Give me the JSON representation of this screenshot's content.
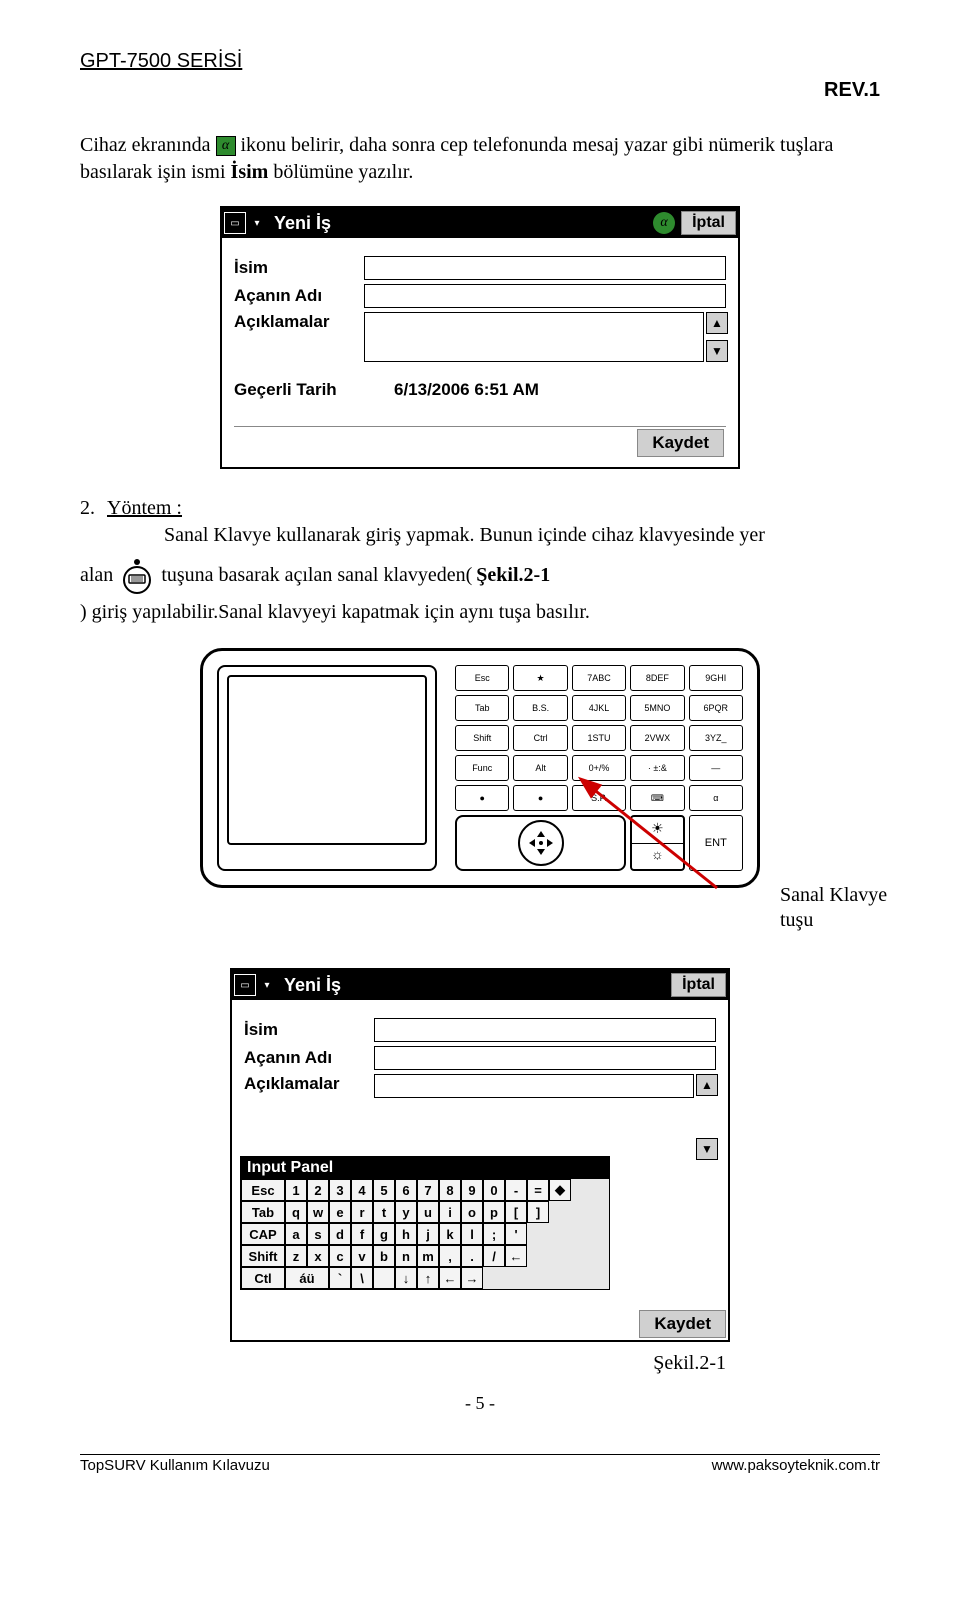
{
  "header": {
    "series": "GPT-7500 SERİSİ",
    "rev": "REV.1"
  },
  "intro": {
    "before_icon": "Cihaz ekranında",
    "alpha_glyph": "α",
    "after_icon": "ikonu belirir, daha sonra cep telefonunda mesaj yazar gibi nümerik tuşlara basılarak işin ismi ",
    "bold_isim": "İsim",
    "after_isim": " bölümüne yazılır."
  },
  "ss1": {
    "title": "Yeni İş",
    "alpha": "α",
    "cancel": "İptal",
    "labels": {
      "isim": "İsim",
      "acan": "Açanın Adı",
      "acik": "Açıklamalar",
      "tarih": "Geçerli Tarih"
    },
    "date_value": "6/13/2006 6:51 AM",
    "save": "Kaydet"
  },
  "method": {
    "num": "2.",
    "title": "Yöntem :",
    "line1": "Sanal Klavye kullanarak giriş yapmak. Bunun içinde cihaz klavyesinde yer",
    "line2a": "alan",
    "line2b": "tuşuna basarak açılan sanal klavyeden(",
    "ref": "Şekil.2-1",
    "line2c": ") giriş yapılabilir.Sanal klavyeyi kapatmak için aynı tuşa basılır."
  },
  "device": {
    "keys_r1": [
      "Esc",
      "★",
      "7ABC",
      "8DEF",
      "9GHI"
    ],
    "keys_r2": [
      "Tab",
      "B.S.",
      "4JKL",
      "5MNO",
      "6PQR"
    ],
    "keys_r3": [
      "Shift",
      "Ctrl",
      "1STU",
      "2VWX",
      "3YZ_"
    ],
    "keys_r4": [
      "Func",
      "Alt",
      "0+/%",
      "· ±:&",
      "—"
    ],
    "keys_r5": [
      "●",
      "●",
      "S.P.",
      "⌨",
      "α"
    ],
    "ent": "ENT",
    "label": "Sanal Klavye tuşu"
  },
  "ss2": {
    "title": "Yeni İş",
    "cancel": "İptal",
    "labels": {
      "isim": "İsim",
      "acan": "Açanın Adı",
      "acik": "Açıklamalar"
    },
    "panel_title": "Input Panel",
    "save": "Kaydet",
    "rows": {
      "r1": [
        "Esc",
        "1",
        "2",
        "3",
        "4",
        "5",
        "6",
        "7",
        "8",
        "9",
        "0",
        "-",
        "=",
        "◆"
      ],
      "r2": [
        "Tab",
        "q",
        "w",
        "e",
        "r",
        "t",
        "y",
        "u",
        "i",
        "o",
        "p",
        "[",
        "]"
      ],
      "r3": [
        "CAP",
        "a",
        "s",
        "d",
        "f",
        "g",
        "h",
        "j",
        "k",
        "l",
        ";",
        "'"
      ],
      "r4": [
        "Shift",
        "z",
        "x",
        "c",
        "v",
        "b",
        "n",
        "m",
        ",",
        ".",
        "/",
        "←"
      ],
      "r5": [
        "Ctl",
        "áü",
        "`",
        "\\",
        " ",
        "↓",
        "↑",
        "←",
        "→"
      ]
    },
    "caption": "Şekil.2-1"
  },
  "footer": {
    "left": "TopSURV Kullanım Kılavuzu",
    "right": "www.paksoyteknik.com.tr",
    "page": "- 5 -"
  }
}
